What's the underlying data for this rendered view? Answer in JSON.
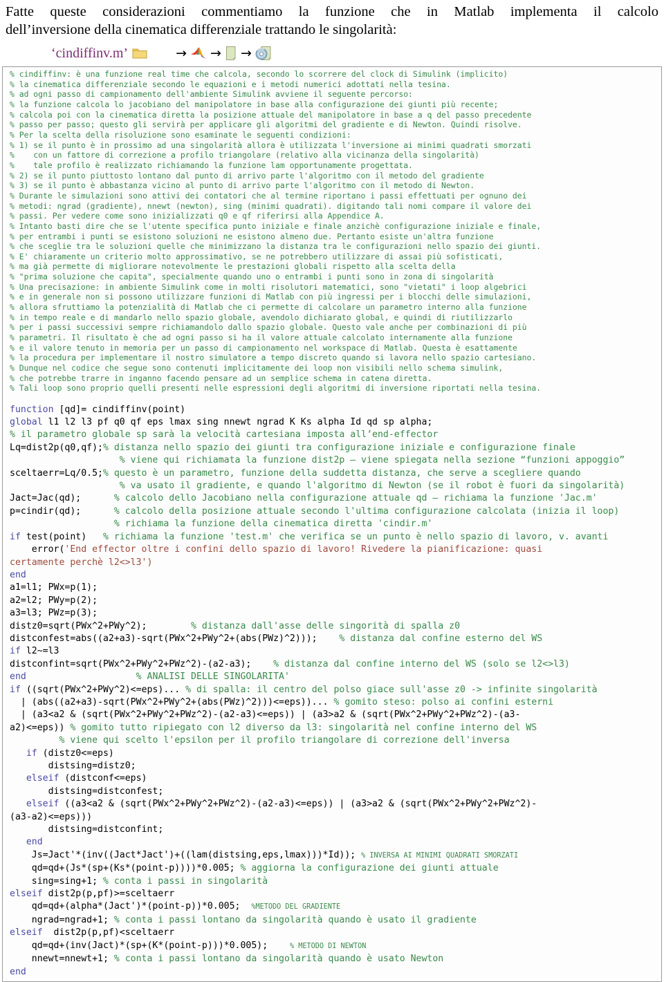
{
  "intro": {
    "line1": "Fatte queste considerazioni commentiamo la funzione che in Matlab implementa il calcolo",
    "line2": "dell’inversione della cinematica differenziale trattando le singolarità:"
  },
  "chain": {
    "filename": "‘cindiffinv.m’",
    "arrow": "→",
    "icons": [
      {
        "name": "folder-icon",
        "label": "folder"
      },
      {
        "name": "matlab-logo-icon",
        "label": "matlab"
      },
      {
        "name": "document-page-icon",
        "label": "page"
      },
      {
        "name": "cd-document-icon",
        "label": "cd"
      }
    ]
  },
  "colors": {
    "comment": "#3a8a4a",
    "keyword": "#4a4aa6",
    "string": "#9e4a3c",
    "filename": "#7B2E71",
    "border": "#9a9a9a",
    "background": "#ffffff"
  },
  "code_header_comments": [
    "% cindiffinv: è una funzione real time che calcola, secondo lo scorrere del clock di Simulink (implicito)",
    "% la cinematica differenziale secondo le equazioni e i metodi numerici adottati nella tesina.",
    "% ad ogni passo di campionamento dell'ambiente Simulink avviene il seguente percorso:",
    "% la funzione calcola lo jacobiano del manipolatore in base alla configurazione dei giunti più recente;",
    "% calcola poi con la cinematica diretta la posizione attuale del manipolatore in base a q del passo precedente",
    "% passo per passo; questo gli servirà per applicare gli algoritmi del gradiente e di Newton. Quindi risolve.",
    "% Per la scelta della risoluzione sono esaminate le seguenti condizioni:",
    "% 1) se il punto è in prossimo ad una singolarità allora è utilizzata l'inversione ai minimi quadrati smorzati",
    "%    con un fattore di correzione a profilo triangolare (relativo alla vicinanza della singolarità)",
    "%    tale profilo è realizzato richiamando la funzione lam opportunamente progettata.",
    "% 2) se il punto piuttosto lontano dal punto di arrivo parte l'algoritmo con il metodo del gradiente",
    "% 3) se il punto è abbastanza vicino al punto di arrivo parte l'algoritmo con il metodo di Newton.",
    "% Durante le simulazioni sono attivi dei contatori che al termine riportano i passi effettuati per ognuno dei",
    "% metodi: ngrad (gradiente), nnewt (newton), sing (minimi quadrati). digitando tali nomi compare il valore dei",
    "% passi. Per vedere come sono inizializzati q0 e qf riferirsi alla Appendice A.",
    "% Intanto basti dire che se l'utente specifica punto iniziale e finale anzichè configurazione iniziale e finale,",
    "% per entrambi i punti se esistono soluzioni ne esistono almeno due. Pertanto esiste un'altra funzione",
    "% che sceglie tra le soluzioni quelle che minimizzano la distanza tra le configurazioni nello spazio dei giunti.",
    "% E' chiaramente un criterio molto approssimativo, se ne potrebbero utilizzare di assai più sofisticati,",
    "% ma già permette di migliorare notevolmente le prestazioni globali rispetto alla scelta della",
    "% \"prima soluzione che capita\", specialmente quando uno o entrambi i punti sono in zona di singolarità",
    "% Una precisazione: in ambiente Simulink come in molti risolutori matematici, sono \"vietati\" i loop algebrici",
    "% e in generale non si possono utilizzare funzioni di Matlab con più ingressi per i blocchi delle simulazioni,",
    "% allora sfruttiamo la potenzialità di Matlab che ci permette di calcolare un parametro interno alla funzione",
    "% in tempo reale e di mandarlo nello spazio globale, avendolo dichiarato global, e quindi di riutilizzarlo",
    "% per i passi successivi sempre richiamandolo dallo spazio globale. Questo vale anche per combinazioni di più",
    "% parametri. Il risultato è che ad ogni passo si ha il valore attuale calcolato internamente alla funzione",
    "% e il valore tenuto in memoria per un passo di campionamento nel workspace di Matlab. Questa è esattamente",
    "% la procedura per implementare il nostro simulatore a tempo discreto quando si lavora nello spazio cartesiano.",
    "% Dunque nel codice che segue sono contenuti implicitamente dei loop non visibili nello schema simulink,",
    "% che potrebbe trarre in inganno facendo pensare ad un semplice schema in catena diretta.",
    "% Tali loop sono proprio quelli presenti nelle espressioni degli algoritmi di inversione riportati nella tesina."
  ],
  "code_lines": [
    {
      "parts": [
        {
          "t": "function",
          "c": "kw"
        },
        {
          "t": " [qd]= cindiffinv(point)",
          "c": ""
        }
      ]
    },
    {
      "parts": [
        {
          "t": "global",
          "c": "kw"
        },
        {
          "t": " l1 l2 l3 pf q0 qf eps lmax sing nnewt ngrad K Ks alpha Id qd sp alpha;",
          "c": ""
        }
      ]
    },
    {
      "parts": [
        {
          "t": "% il parametro globale sp sarà la velocità cartesiana imposta all’end-effector",
          "c": "cm"
        }
      ]
    },
    {
      "parts": [
        {
          "t": "Lq=dist2p(q0,qf);",
          "c": ""
        },
        {
          "t": "% distanza nello spazio dei giunti tra configurazione iniziale e configurazione finale",
          "c": "cm"
        }
      ]
    },
    {
      "parts": [
        {
          "t": "                    ",
          "c": ""
        },
        {
          "t": "% viene qui richiamata la funzione dist2p – viene spiegata nella sezione “funzioni appoggio”",
          "c": "cm"
        }
      ]
    },
    {
      "parts": [
        {
          "t": "sceltaerr=Lq/0.5;",
          "c": ""
        },
        {
          "t": "% questo è un parametro, funzione della suddetta distanza, che serve a scegliere quando",
          "c": "cm"
        }
      ]
    },
    {
      "parts": [
        {
          "t": "                    ",
          "c": ""
        },
        {
          "t": "% va usato il gradiente, e quando l'algoritmo di Newton (se il robot è fuori da singolarità)",
          "c": "cm"
        }
      ]
    },
    {
      "parts": [
        {
          "t": "Jact=Jac(qd);      ",
          "c": ""
        },
        {
          "t": "% calcolo dello Jacobiano nella configurazione attuale qd – richiama la funzione 'Jac.m'",
          "c": "cm"
        }
      ]
    },
    {
      "parts": [
        {
          "t": "p=cindir(qd);      ",
          "c": ""
        },
        {
          "t": "% calcolo della posizione attuale secondo l'ultima configurazione calcolata (inizia il loop)",
          "c": "cm"
        }
      ]
    },
    {
      "parts": [
        {
          "t": "                   ",
          "c": ""
        },
        {
          "t": "% richiama la funzione della cinematica diretta 'cindir.m'",
          "c": "cm"
        }
      ]
    },
    {
      "parts": [
        {
          "t": "if",
          "c": "kw"
        },
        {
          "t": " test(point)   ",
          "c": ""
        },
        {
          "t": "% richiama la funzione 'test.m' che verifica se un punto è nello spazio di lavoro, v. avanti",
          "c": "cm"
        }
      ]
    },
    {
      "parts": [
        {
          "t": "    error(",
          "c": ""
        },
        {
          "t": "'End effector oltre i confini dello spazio di lavoro! Rivedere la pianificazione: quasi",
          "c": "str"
        }
      ]
    },
    {
      "parts": [
        {
          "t": "certamente perchè l2<>l3')",
          "c": "str"
        }
      ]
    },
    {
      "parts": [
        {
          "t": "end",
          "c": "kw"
        }
      ]
    },
    {
      "parts": [
        {
          "t": "a1=l1; PWx=p(1);",
          "c": ""
        }
      ]
    },
    {
      "parts": [
        {
          "t": "a2=l2; PWy=p(2);",
          "c": ""
        }
      ]
    },
    {
      "parts": [
        {
          "t": "a3=l3; PWz=p(3);",
          "c": ""
        }
      ]
    },
    {
      "parts": [
        {
          "t": "distz0=sqrt(PWx^2+PWy^2);        ",
          "c": ""
        },
        {
          "t": "% distanza dall'asse delle singorità di spalla z0",
          "c": "cm"
        }
      ]
    },
    {
      "parts": [
        {
          "t": "distconfest=abs((a2+a3)-sqrt(PWx^2+PWy^2+(abs(PWz)^2)));    ",
          "c": ""
        },
        {
          "t": "% distanza dal confine esterno del WS",
          "c": "cm"
        }
      ]
    },
    {
      "parts": [
        {
          "t": "if",
          "c": "kw"
        },
        {
          "t": " l2~=l3",
          "c": ""
        }
      ]
    },
    {
      "parts": [
        {
          "t": "distconfint=sqrt(PWx^2+PWy^2+PWz^2)-(a2-a3);    ",
          "c": ""
        },
        {
          "t": "% distanza dal confine interno del WS (solo se l2<>l3)",
          "c": "cm"
        }
      ]
    },
    {
      "parts": [
        {
          "t": "end",
          "c": "kw"
        },
        {
          "t": "                    ",
          "c": ""
        },
        {
          "t": "% ANALISI DELLE SINGOLARITA'",
          "c": "cm"
        }
      ]
    },
    {
      "parts": [
        {
          "t": "if",
          "c": "kw"
        },
        {
          "t": " ((sqrt(PWx^2+PWy^2)<=eps)... ",
          "c": ""
        },
        {
          "t": "% di spalla: il centro del polso giace sull'asse z0 -> infinite singolarità",
          "c": "cm"
        }
      ]
    },
    {
      "parts": [
        {
          "t": "  | (abs((a2+a3)-sqrt(PWx^2+PWy^2+(abs(PWz)^2)))<=eps))... ",
          "c": ""
        },
        {
          "t": "% gomito steso: polso ai confini esterni",
          "c": "cm"
        }
      ]
    },
    {
      "parts": [
        {
          "t": "  | (a3<a2 & (sqrt(PWx^2+PWy^2+PWz^2)-(a2-a3)<=eps)) | (a3>a2 & (sqrt(PWx^2+PWy^2+PWz^2)-(a3-",
          "c": ""
        }
      ]
    },
    {
      "parts": [
        {
          "t": "a2)<=eps)) ",
          "c": ""
        },
        {
          "t": "% gomito tutto ripiegato con l2 diverso da l3: singolarità nel confine interno del WS",
          "c": "cm"
        }
      ]
    },
    {
      "parts": [
        {
          "t": "         ",
          "c": ""
        },
        {
          "t": "% viene qui scelto l'epsilon per il profilo triangolare di correzione dell'inversa",
          "c": "cm"
        }
      ]
    },
    {
      "parts": [
        {
          "t": "   ",
          "c": ""
        },
        {
          "t": "if",
          "c": "kw"
        },
        {
          "t": " (distz0<=eps)",
          "c": ""
        }
      ]
    },
    {
      "parts": [
        {
          "t": "       distsing=distz0;",
          "c": ""
        }
      ]
    },
    {
      "parts": [
        {
          "t": "   ",
          "c": ""
        },
        {
          "t": "elseif",
          "c": "kw"
        },
        {
          "t": " (distconf<=eps)",
          "c": ""
        }
      ]
    },
    {
      "parts": [
        {
          "t": "       distsing=distconfest;",
          "c": ""
        }
      ]
    },
    {
      "parts": [
        {
          "t": "   ",
          "c": ""
        },
        {
          "t": "elseif",
          "c": "kw"
        },
        {
          "t": " ((a3<a2 & (sqrt(PWx^2+PWy^2+PWz^2)-(a2-a3)<=eps)) | (a3>a2 & (sqrt(PWx^2+PWy^2+PWz^2)-",
          "c": ""
        }
      ]
    },
    {
      "parts": [
        {
          "t": "(a3-a2)<=eps)))",
          "c": ""
        }
      ]
    },
    {
      "parts": [
        {
          "t": "       distsing=distconfint;",
          "c": ""
        }
      ]
    },
    {
      "parts": [
        {
          "t": "   ",
          "c": ""
        },
        {
          "t": "end",
          "c": "kw"
        }
      ]
    },
    {
      "parts": [
        {
          "t": "    Js=Jact'*(inv((Jact*Jact')+((lam(distsing,eps,lmax)))*Id)); ",
          "c": ""
        },
        {
          "t": "% INVERSA AI MINIMI QUADRATI SMORZATI",
          "c": "cm small"
        }
      ]
    },
    {
      "parts": [
        {
          "t": "    qd=qd+(Js*(sp+(Ks*(point-p))))*0.005; ",
          "c": ""
        },
        {
          "t": "% aggiorna la configurazione dei giunti attuale",
          "c": "cm"
        }
      ]
    },
    {
      "parts": [
        {
          "t": "    sing=sing+1; ",
          "c": ""
        },
        {
          "t": "% conta i passi in singolarità",
          "c": "cm"
        }
      ]
    },
    {
      "parts": [
        {
          "t": "elseif",
          "c": "kw"
        },
        {
          "t": " dist2p(p,pf)>=sceltaerr",
          "c": ""
        }
      ]
    },
    {
      "parts": [
        {
          "t": "    qd=qd+(alpha*(Jact')*(point-p))*0.005;  ",
          "c": ""
        },
        {
          "t": "%METODO DEL GRADIENTE",
          "c": "cm small"
        }
      ]
    },
    {
      "parts": [
        {
          "t": "    ngrad=ngrad+1; ",
          "c": ""
        },
        {
          "t": "% conta i passi lontano da singolarità quando è usato il gradiente",
          "c": "cm"
        }
      ]
    },
    {
      "parts": [
        {
          "t": "elseif",
          "c": "kw"
        },
        {
          "t": "  dist2p(p,pf)<sceltaerr",
          "c": ""
        }
      ]
    },
    {
      "parts": [
        {
          "t": "    qd=qd+(inv(Jact)*(sp+(K*(point-p)))*0.005);    ",
          "c": ""
        },
        {
          "t": "% METODO DI NEWTON",
          "c": "cm small"
        }
      ]
    },
    {
      "parts": [
        {
          "t": "    nnewt=nnewt+1; ",
          "c": ""
        },
        {
          "t": "% conta i passi lontano da singolarità quando è usato Newton",
          "c": "cm"
        }
      ]
    },
    {
      "parts": [
        {
          "t": "end",
          "c": "kw"
        }
      ]
    }
  ]
}
